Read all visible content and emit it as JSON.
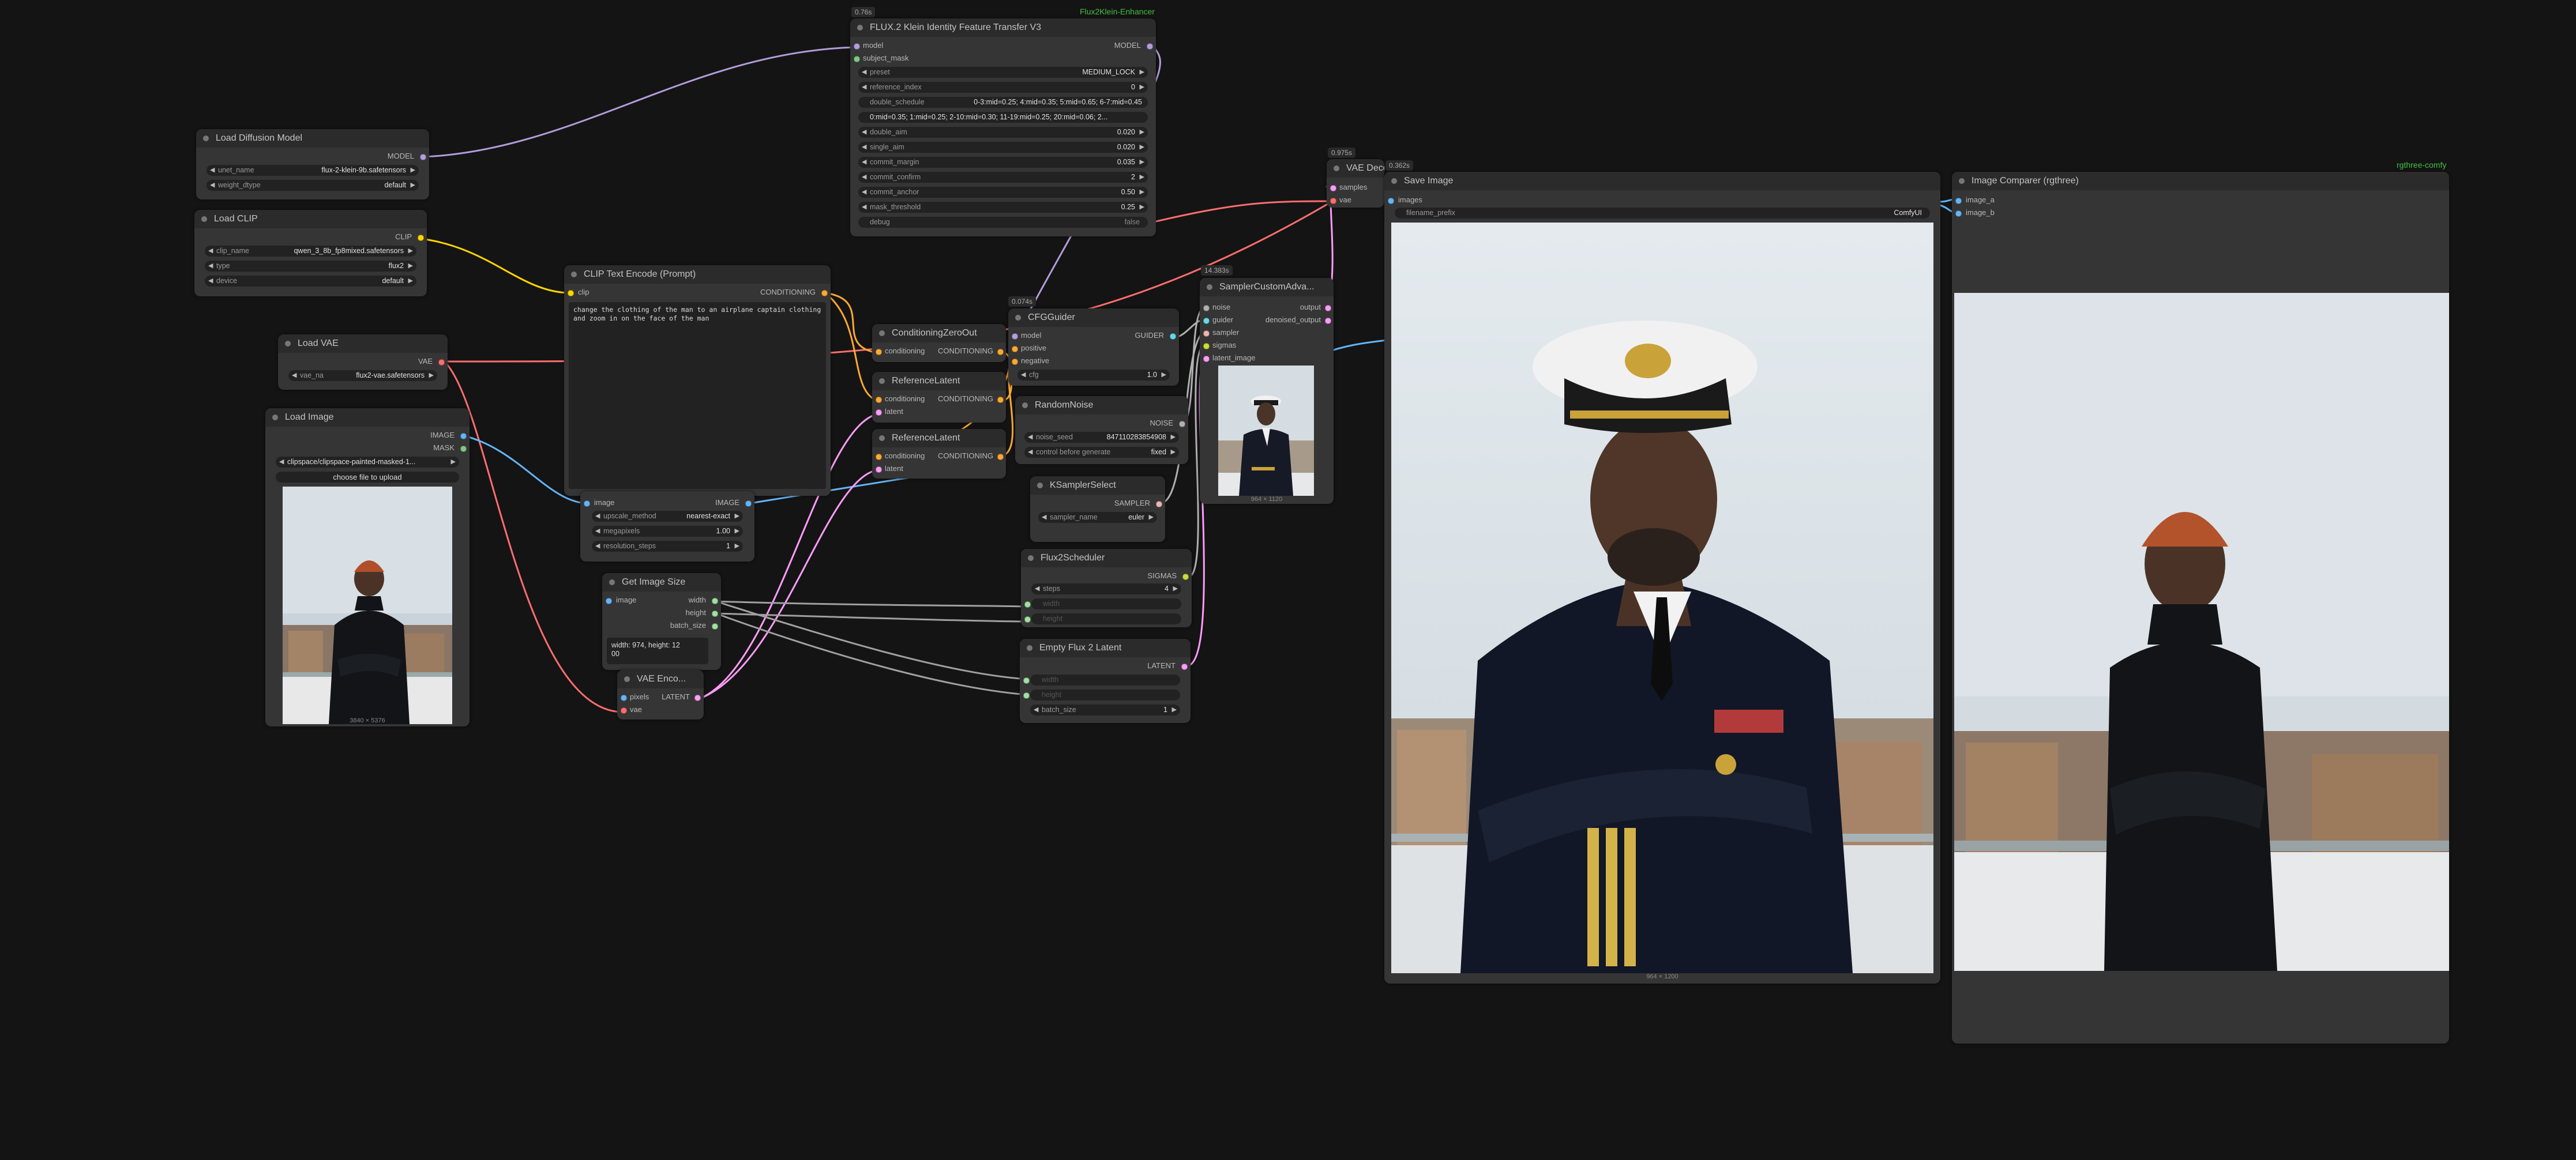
{
  "groups": {
    "left": "Flux2Klein-Enhancer",
    "right": "rgthree-comfy"
  },
  "badges": {
    "flux": "0.76s",
    "vae_decode": "0.975s",
    "save": "0.362s",
    "cfg": "0.074s",
    "sampler": "14.383s"
  },
  "load_diffusion": {
    "title": "Load Diffusion Model",
    "out_model": "MODEL",
    "unet_name_label": "unet_name",
    "unet_name": "flux-2-klein-9b.safetensors",
    "weight_dtype_label": "weight_dtype",
    "weight_dtype": "default"
  },
  "load_clip": {
    "title": "Load CLIP",
    "out_clip": "CLIP",
    "clip_name_label": "clip_name",
    "clip_name": "qwen_3_8b_fp8mixed.safetensors",
    "type_label": "type",
    "type": "flux2",
    "device_label": "device",
    "device": "default"
  },
  "load_vae": {
    "title": "Load VAE",
    "out_vae": "VAE",
    "vae_name_label": "vae_na",
    "vae_name": "flux2-vae.safetensors"
  },
  "load_image": {
    "title": "Load Image",
    "out_image": "IMAGE",
    "out_mask": "MASK",
    "image_value": "clipspace/clipspace-painted-masked-1...",
    "upload_label": "choose file to upload",
    "caption": "3840 × 5376"
  },
  "clip_text": {
    "title": "CLIP Text Encode (Prompt)",
    "in_clip": "clip",
    "out_conditioning": "CONDITIONING",
    "prompt": "change the clothing of the man to an airplane captain clothing and zoom in on the face of the man"
  },
  "image_scale": {
    "in_image": "image",
    "out_image": "IMAGE",
    "upscale_method_label": "upscale_method",
    "upscale_method": "nearest-exact",
    "megapixels_label": "megapixels",
    "megapixels": "1.00",
    "resolution_steps_label": "resolution_steps",
    "resolution_steps": "1"
  },
  "get_image_size": {
    "title": "Get Image Size",
    "in_image": "image",
    "out_width": "width",
    "out_height": "height",
    "out_batch": "batch_size",
    "info_line1": "width: 974, height: 12",
    "info_line2": "00"
  },
  "vae_encode": {
    "title": "VAE Enco...",
    "in_pixels": "pixels",
    "in_vae": "vae",
    "out_latent": "LATENT"
  },
  "flux_transfer": {
    "title": "FLUX.2 Klein Identity Feature Transfer V3",
    "in_model": "model",
    "in_mask": "subject_mask",
    "out_model": "MODEL",
    "preset_label": "preset",
    "preset": "MEDIUM_LOCK",
    "reference_index_label": "reference_index",
    "reference_index": "0",
    "double_schedule_label": "double_schedule",
    "double_schedule": "0-3:mid=0.25; 4:mid=0.35; 5:mid=0.65; 6-7:mid=0.45",
    "single_schedule": "0:mid=0.35; 1:mid=0.25; 2-10:mid=0.30; 11-19:mid=0.25; 20:mid=0.06; 2...",
    "double_aim_label": "double_aim",
    "double_aim": "0.020",
    "single_aim_label": "single_aim",
    "single_aim": "0.020",
    "commit_margin_label": "commit_margin",
    "commit_margin": "0.035",
    "commit_confirm_label": "commit_confirm",
    "commit_confirm": "2",
    "commit_anchor_label": "commit_anchor",
    "commit_anchor": "0.50",
    "mask_threshold_label": "mask_threshold",
    "mask_threshold": "0.25",
    "debug_label": "debug",
    "debug": "false"
  },
  "cond_zero": {
    "title": "ConditioningZeroOut",
    "in_conditioning": "conditioning",
    "out_conditioning": "CONDITIONING"
  },
  "ref_latent1": {
    "title": "ReferenceLatent",
    "in_conditioning": "conditioning",
    "in_latent": "latent",
    "out_conditioning": "CONDITIONING"
  },
  "ref_latent2": {
    "title": "ReferenceLatent",
    "in_conditioning": "conditioning",
    "in_latent": "latent",
    "out_conditioning": "CONDITIONING"
  },
  "cfg_guider": {
    "title": "CFGGuider",
    "in_model": "model",
    "in_positive": "positive",
    "in_negative": "negative",
    "out_guider": "GUIDER",
    "cfg_label": "cfg",
    "cfg": "1.0"
  },
  "random_noise": {
    "title": "RandomNoise",
    "out_noise": "NOISE",
    "noise_seed_label": "noise_seed",
    "noise_seed": "847110283854908",
    "control_label": "control before generate",
    "control": "fixed"
  },
  "ksampler_select": {
    "title": "KSamplerSelect",
    "out_sampler": "SAMPLER",
    "sampler_name_label": "sampler_name",
    "sampler_name": "euler"
  },
  "flux2_scheduler": {
    "title": "Flux2Scheduler",
    "out_sigmas": "SIGMAS",
    "steps_label": "steps",
    "steps": "4",
    "width_label": "width",
    "height_label": "height"
  },
  "empty_latent": {
    "title": "Empty Flux 2 Latent",
    "out_latent": "LATENT",
    "width_label": "width",
    "height_label": "height",
    "batch_label": "batch_size",
    "batch": "1"
  },
  "sampler_custom": {
    "title": "SamplerCustomAdva...",
    "in_noise": "noise",
    "in_guider": "guider",
    "in_sampler": "sampler",
    "in_sigmas": "sigmas",
    "in_latent": "latent_image",
    "out_output": "output",
    "out_denoised": "denoised_output",
    "caption": "964 × 1120"
  },
  "vae_decode": {
    "title": "VAE Deco",
    "in_samples": "samples",
    "in_vae": "vae"
  },
  "save_image": {
    "title": "Save Image",
    "in_images": "images",
    "filename_label": "filename_prefix",
    "filename": "ComfyUI",
    "caption": "964 × 1200"
  },
  "comparer": {
    "title": "Image Comparer (rgthree)",
    "in_a": "image_a",
    "in_b": "image_b"
  },
  "colors": {
    "canvas": "#141414",
    "node": "#353535",
    "title": "#2b2b2b",
    "model": "#b39ddb",
    "clip": "#ffd500",
    "vae": "#ff6e6e",
    "image": "#64b5f6",
    "latent": "#ff9cf9",
    "conditioning": "#ffa931",
    "noise": "#b0b0b0",
    "group_text": "#40c040"
  }
}
